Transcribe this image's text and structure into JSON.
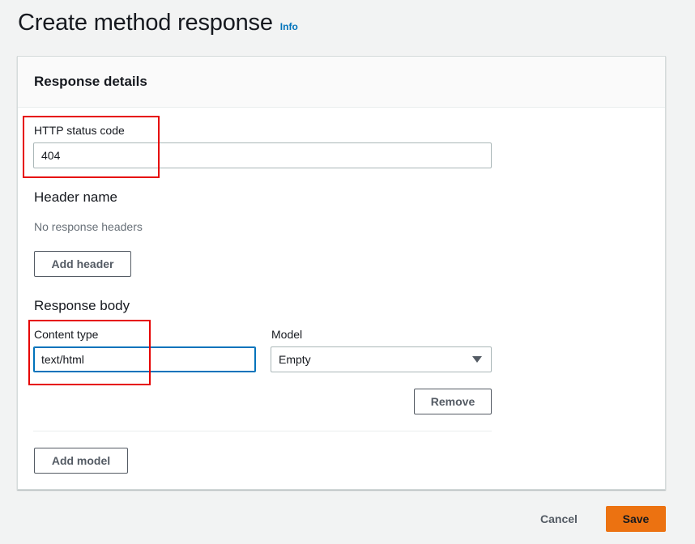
{
  "page": {
    "title": "Create method response",
    "info_link": "Info"
  },
  "panel": {
    "title": "Response details"
  },
  "status_code": {
    "label": "HTTP status code",
    "value": "404"
  },
  "headers": {
    "heading": "Header name",
    "empty_text": "No response headers",
    "add_button": "Add header"
  },
  "response_body": {
    "heading": "Response body",
    "content_type_label": "Content type",
    "content_type_value": "text/html",
    "model_label": "Model",
    "model_value": "Empty",
    "remove_button": "Remove",
    "add_model_button": "Add model"
  },
  "footer": {
    "cancel_label": "Cancel",
    "save_label": "Save"
  },
  "colors": {
    "primary": "#ec7211",
    "link": "#0073bb",
    "highlight": "#e60000"
  }
}
